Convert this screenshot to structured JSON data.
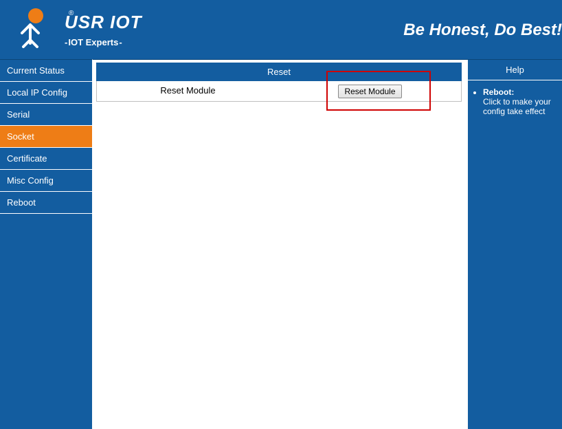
{
  "colors": {
    "primary": "#135da0",
    "accent": "#ee7d16",
    "highlightBorder": "#cf0000"
  },
  "header": {
    "brand": "USR IOT",
    "tagline": "IOT Experts",
    "slogan": "Be Honest, Do Best!"
  },
  "sidebar": {
    "items": [
      {
        "label": "Current Status"
      },
      {
        "label": "Local IP Config"
      },
      {
        "label": "Serial"
      },
      {
        "label": "Socket"
      },
      {
        "label": "Certificate"
      },
      {
        "label": "Misc Config"
      },
      {
        "label": "Reboot"
      }
    ],
    "activeIndex": 3
  },
  "main": {
    "tableHeader": "Reset",
    "rowLabel": "Reset Module",
    "buttonLabel": "Reset Module"
  },
  "help": {
    "title": "Help",
    "itemTitle": "Reboot:",
    "itemText": "Click to make your config take effect"
  }
}
